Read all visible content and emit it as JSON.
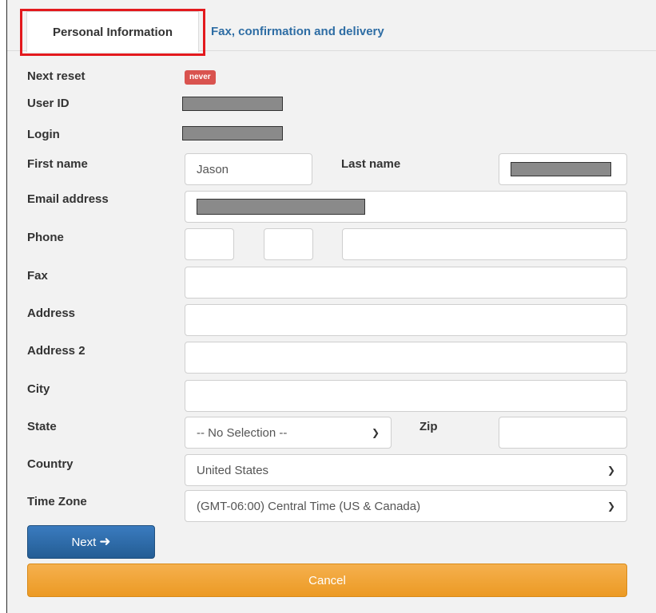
{
  "tabs": {
    "active": "Personal Information",
    "other": "Fax, confirmation and delivery"
  },
  "labels": {
    "next_reset": "Next reset",
    "user_id": "User ID",
    "login": "Login",
    "first_name": "First name",
    "last_name": "Last name",
    "email": "Email address",
    "phone": "Phone",
    "fax": "Fax",
    "address": "Address",
    "address2": "Address 2",
    "city": "City",
    "state": "State",
    "zip": "Zip",
    "country": "Country",
    "time_zone": "Time Zone"
  },
  "badge": {
    "next_reset": "never"
  },
  "fields": {
    "first_name": "Jason",
    "state": "-- No Selection --",
    "country": "United States",
    "time_zone": "(GMT-06:00) Central Time (US & Canada)"
  },
  "buttons": {
    "next": "Next",
    "cancel": "Cancel"
  },
  "colors": {
    "highlight": "#e3191d",
    "badge": "#d9534f",
    "next_button": "#2e6da4",
    "cancel_button": "#f0a030",
    "tab_link": "#2e6da4"
  },
  "icons": {
    "next_arrow": "arrow-right-icon",
    "select_chevron": "chevron-down-icon"
  }
}
